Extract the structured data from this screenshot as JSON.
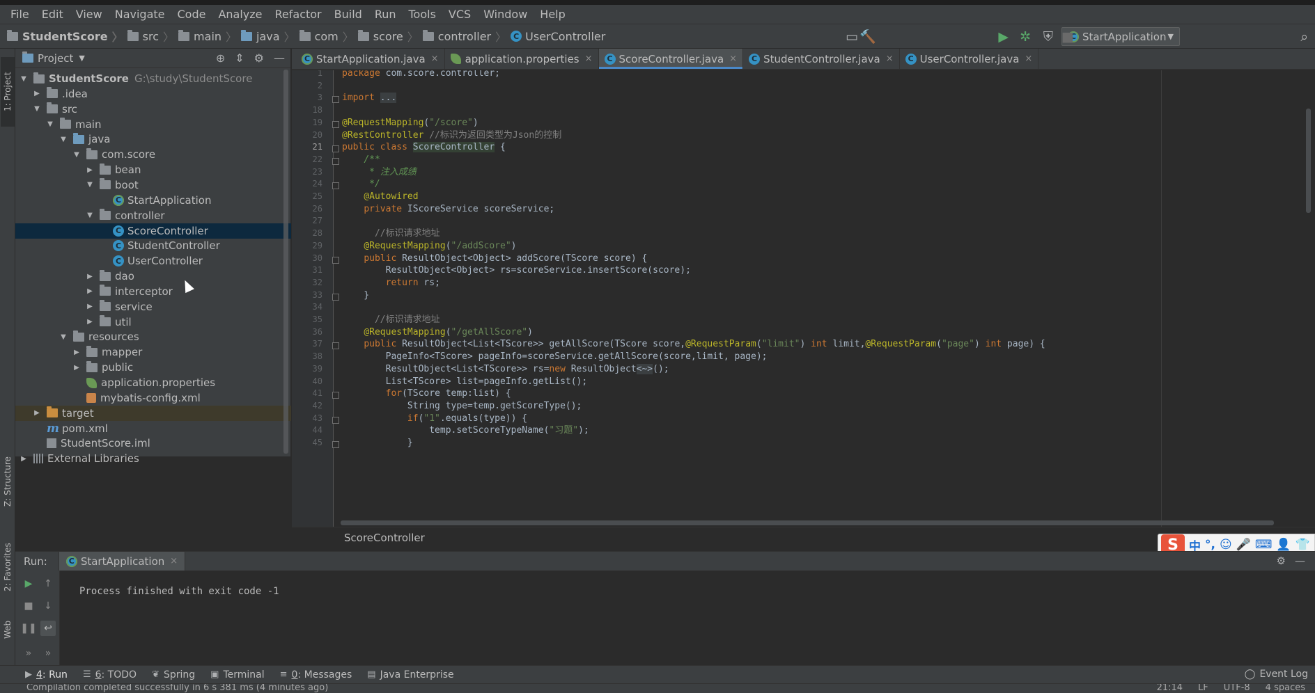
{
  "menu": [
    "File",
    "Edit",
    "View",
    "Navigate",
    "Code",
    "Analyze",
    "Refactor",
    "Build",
    "Run",
    "Tools",
    "VCS",
    "Window",
    "Help"
  ],
  "breadcrumb": [
    "StudentScore",
    "src",
    "main",
    "java",
    "com",
    "score",
    "controller",
    "UserController"
  ],
  "run_config": "StartApplication",
  "left_strip": {
    "project": "1: Project",
    "structure": "Z: Structure",
    "favorites": "2: Favorites",
    "web": "Web"
  },
  "project_panel": {
    "title": "Project",
    "tree": [
      {
        "label": "StudentScore",
        "path": "G:\\study\\StudentScore",
        "depth": 0,
        "expanded": true,
        "icon": "module-folder-icon"
      },
      {
        "label": ".idea",
        "depth": 1,
        "expanded": false,
        "icon": "folder-icon"
      },
      {
        "label": "src",
        "depth": 1,
        "expanded": true,
        "icon": "folder-icon"
      },
      {
        "label": "main",
        "depth": 2,
        "expanded": true,
        "icon": "folder-icon"
      },
      {
        "label": "java",
        "depth": 3,
        "expanded": true,
        "icon": "source-folder-icon"
      },
      {
        "label": "com.score",
        "depth": 4,
        "expanded": true,
        "icon": "package-icon"
      },
      {
        "label": "bean",
        "depth": 5,
        "expanded": false,
        "icon": "package-icon"
      },
      {
        "label": "boot",
        "depth": 5,
        "expanded": true,
        "icon": "package-icon"
      },
      {
        "label": "StartApplication",
        "depth": 6,
        "icon": "spring-class-icon"
      },
      {
        "label": "controller",
        "depth": 5,
        "expanded": true,
        "icon": "package-icon"
      },
      {
        "label": "ScoreController",
        "depth": 6,
        "icon": "class-icon",
        "selected": true
      },
      {
        "label": "StudentController",
        "depth": 6,
        "icon": "class-icon"
      },
      {
        "label": "UserController",
        "depth": 6,
        "icon": "class-icon"
      },
      {
        "label": "dao",
        "depth": 5,
        "expanded": false,
        "icon": "package-icon"
      },
      {
        "label": "interceptor",
        "depth": 5,
        "expanded": false,
        "icon": "package-icon"
      },
      {
        "label": "service",
        "depth": 5,
        "expanded": false,
        "icon": "package-icon"
      },
      {
        "label": "util",
        "depth": 5,
        "expanded": false,
        "icon": "package-icon"
      },
      {
        "label": "resources",
        "depth": 3,
        "expanded": true,
        "icon": "resources-folder-icon"
      },
      {
        "label": "mapper",
        "depth": 4,
        "expanded": false,
        "icon": "folder-icon"
      },
      {
        "label": "public",
        "depth": 4,
        "expanded": false,
        "icon": "folder-icon"
      },
      {
        "label": "application.properties",
        "depth": 4,
        "icon": "spring-properties-icon"
      },
      {
        "label": "mybatis-config.xml",
        "depth": 4,
        "icon": "xml-file-icon"
      },
      {
        "label": "target",
        "depth": 1,
        "expanded": false,
        "icon": "excluded-folder-icon"
      },
      {
        "label": "pom.xml",
        "depth": 1,
        "icon": "maven-icon"
      },
      {
        "label": "StudentScore.iml",
        "depth": 1,
        "icon": "iml-file-icon"
      },
      {
        "label": "External Libraries",
        "depth": 0,
        "expanded": false,
        "icon": "library-icon"
      }
    ]
  },
  "editor_tabs": [
    {
      "label": "StartApplication.java",
      "active": false
    },
    {
      "label": "application.properties",
      "active": false
    },
    {
      "label": "ScoreController.java",
      "active": true
    },
    {
      "label": "StudentController.java",
      "active": false
    },
    {
      "label": "UserController.java",
      "active": false
    }
  ],
  "editor": {
    "lines": [
      {
        "n": "1",
        "html": "<span class=\"kw\">package</span> com.score.controller;"
      },
      {
        "n": "2",
        "html": ""
      },
      {
        "n": "3",
        "html": "<span class=\"kw\">import</span> <span class=\"fold-txt\">...</span>"
      },
      {
        "n": "18",
        "html": ""
      },
      {
        "n": "19",
        "html": "<span class=\"an\">@RequestMapping</span>(<span class=\"str\">\"/score\"</span>)"
      },
      {
        "n": "20",
        "html": "<span class=\"an\">@RestController</span> <span class=\"cm\">//标识为返回类型为Json的控制</span>"
      },
      {
        "n": "21",
        "html": "<span class=\"kw\">public class</span> <span class=\"hl-ident\">ScoreController</span> {"
      },
      {
        "n": "22",
        "html": "    <span class=\"doc\">/**</span>"
      },
      {
        "n": "23",
        "html": "<span class=\"doc\">     * 注入成绩</span>"
      },
      {
        "n": "24",
        "html": "<span class=\"doc\">     */</span>"
      },
      {
        "n": "25",
        "html": "    <span class=\"an\">@Autowired</span>"
      },
      {
        "n": "26",
        "html": "    <span class=\"kw\">private</span> IScoreService scoreService;"
      },
      {
        "n": "27",
        "html": ""
      },
      {
        "n": "28",
        "html": "      <span class=\"cm\">//标识请求地址</span>"
      },
      {
        "n": "29",
        "html": "    <span class=\"an\">@RequestMapping</span>(<span class=\"str\">\"/addScore\"</span>)"
      },
      {
        "n": "30",
        "html": "    <span class=\"kw\">public</span> ResultObject&lt;Object&gt; addScore(TScore score) {"
      },
      {
        "n": "31",
        "html": "        ResultObject&lt;Object&gt; rs=scoreService.insertScore(score);"
      },
      {
        "n": "32",
        "html": "        <span class=\"kw\">return</span> rs;"
      },
      {
        "n": "33",
        "html": "    }"
      },
      {
        "n": "34",
        "html": ""
      },
      {
        "n": "35",
        "html": "      <span class=\"cm\">//标识请求地址</span>"
      },
      {
        "n": "36",
        "html": "    <span class=\"an\">@RequestMapping</span>(<span class=\"str\">\"/getAllScore\"</span>)"
      },
      {
        "n": "37",
        "html": "    <span class=\"kw\">public</span> ResultObject&lt;List&lt;TScore&gt;&gt; getAllScore(TScore score,<span class=\"an\">@RequestParam</span>(<span class=\"str\">\"limit\"</span>) <span class=\"kw\">int</span> limit,<span class=\"an\">@RequestParam</span>(<span class=\"str\">\"page\"</span>) <span class=\"kw\">int</span> page) {"
      },
      {
        "n": "38",
        "html": "        PageInfo&lt;TScore&gt; pageInfo=scoreService.getAllScore(score,limit, page);"
      },
      {
        "n": "39",
        "html": "        ResultObject&lt;List&lt;TScore&gt;&gt; rs=<span class=\"kw\">new</span> ResultObject<span class=\"fold-txt\">&lt;~&gt;</span>();"
      },
      {
        "n": "40",
        "html": "        List&lt;TScore&gt; list=pageInfo.getList();"
      },
      {
        "n": "41",
        "html": "        <span class=\"kw\">for</span>(TScore temp:list) {"
      },
      {
        "n": "42",
        "html": "            String type=temp.getScoreType();"
      },
      {
        "n": "43",
        "html": "            <span class=\"kw\">if</span>(<span class=\"str\">\"1\"</span>.equals(type)) {"
      },
      {
        "n": "44",
        "html": "                temp.setScoreTypeName(<span class=\"str\">\"习题\"</span>);"
      },
      {
        "n": "45",
        "html": "            }"
      }
    ],
    "current_line": "21",
    "breadcrumb": "ScoreController"
  },
  "run_panel": {
    "label": "Run:",
    "tab": "StartApplication",
    "output": "Process finished with exit code -1"
  },
  "bottom_tools": [
    {
      "key": "4",
      "label": ": Run",
      "icon": "run-icon",
      "active": true
    },
    {
      "key": "6",
      "label": ": TODO",
      "icon": "todo-icon"
    },
    {
      "key": "",
      "label": "Spring",
      "icon": "spring-icon"
    },
    {
      "key": "",
      "label": "Terminal",
      "icon": "terminal-icon"
    },
    {
      "key": "0",
      "label": ": Messages",
      "icon": "messages-icon"
    },
    {
      "key": "",
      "label": "Java Enterprise",
      "icon": "java-enterprise-icon"
    }
  ],
  "event_log": "Event Log",
  "status": {
    "message": "Compilation completed successfully in 6 s 381 ms (4 minutes ago)",
    "position": "21:14",
    "line_sep": "LF",
    "encoding": "UTF-8",
    "indent": "4 spaces"
  },
  "ime": {
    "mode": "中",
    "punct": "°,"
  }
}
